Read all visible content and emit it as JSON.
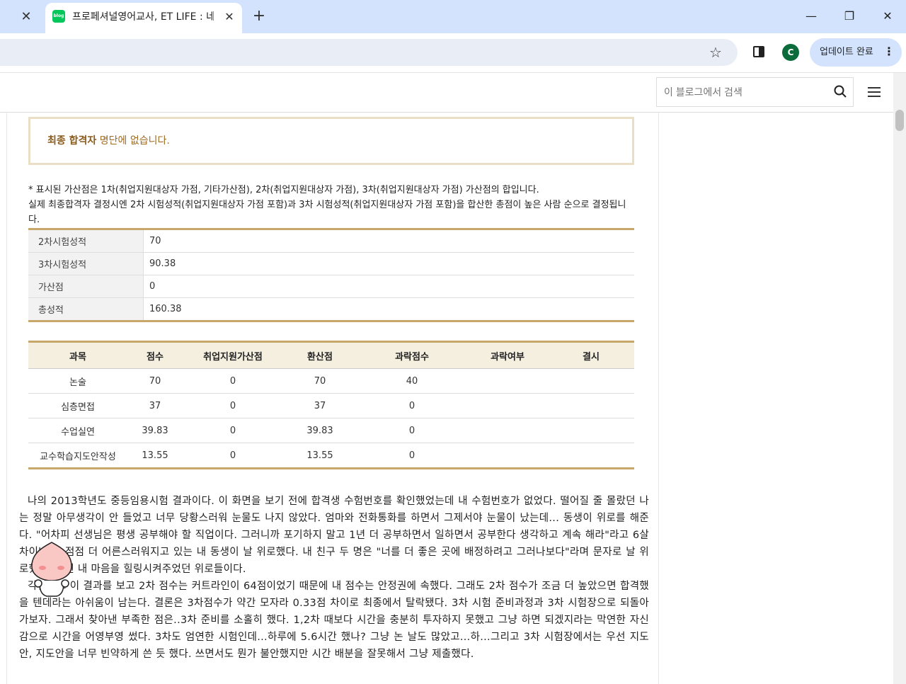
{
  "browser": {
    "tab_title": "프로페셔널영어교사, ET LIFE : 네",
    "favicon_text": "blog",
    "tab_close": "✕",
    "new_tab": "+",
    "close_x": "✕",
    "avatar_letter": "C",
    "update_label": "업데이트 완료",
    "kebab": "⋮",
    "window_controls": [
      "—",
      "❐",
      "✕"
    ]
  },
  "header": {
    "search_placeholder": "이 블로그에서 검색"
  },
  "result": {
    "highlight": "최종 합격자",
    "rest": " 명단에 없습니다."
  },
  "note_lines": [
    "* 표시된 가산점은 1차(취업지원대상자 가점, 기타가산점), 2차(취업지원대상자 가점), 3차(취업지원대상자 가점) 가산점의 합입니다.",
    "실제 최종합격자 결정시엔 2차 시험성적(취업지원대상자 가점 포함)과 3차 시험성적(취업지원대상자 가점 포함)을 합산한 총점이 높은 사람 순으로 결정됩니다."
  ],
  "score_rows": [
    {
      "label": "2차시험성적",
      "value": "70"
    },
    {
      "label": "3차시험성적",
      "value": "90.38"
    },
    {
      "label": "가산점",
      "value": "0"
    },
    {
      "label": "총성적",
      "value": "160.38"
    }
  ],
  "subject_table": {
    "headers": [
      "과목",
      "점수",
      "취업지원가산점",
      "환산점",
      "과락점수",
      "과락여부",
      "결시"
    ],
    "rows": [
      [
        "논술",
        "70",
        "0",
        "70",
        "40",
        "",
        ""
      ],
      [
        "심층면접",
        "37",
        "0",
        "37",
        "0",
        "",
        ""
      ],
      [
        "수업실연",
        "39.83",
        "0",
        "39.83",
        "0",
        "",
        ""
      ],
      [
        "교수학습지도안작성",
        "13.55",
        "0",
        "13.55",
        "0",
        "",
        ""
      ]
    ]
  },
  "body": {
    "p1": "나의 2013학년도 중등임용시험 결과이다. 이 화면을 보기 전에 합격생 수험번호를 확인했었는데 내 수험번호가 없었다. 떨어질 줄 몰랐던 나는 정말 아무생각이 안 들었고 너무 당황스러워 눈물도 나지 않았다. 엄마와 전화통화를 하면서 그제서야 눈물이 났는데... 동생이 위로를 해준다. \"어차피 선생님은 평생 공부해야 할 직업이다. 그러니까 포기하지 말고 1년 더 공부하면서 일하면서 공부한다 생각하고 계속 해라\"라고 6살 차이나는, 점점 더 어른스러워지고 있는 내 동생이 날 위로했다. 내 친구 두 명은 \"너를 더 좋은 곳에 배정하려고 그러나보다\"라며 문자로 날 위로했다. 다친 내 마음을 힐링시켜주었던 위로들이다.",
    "p2": "각설하고 이 결과를 보고 2차 점수는 커트라인이 64점이었기 때문에 내 점수는 안정권에 속했다. 그래도 2차 점수가 조금 더 높았으면 합격했을 텐데라는 아쉬움이 남는다. 결론은 3차점수가 약간 모자라 0.33점 차이로 최종에서 탈락됐다. 3차 시험 준비과정과 3차 시험장으로 되돌아가보자. 그래서 찾아낸 부족한 점은..3차 준비를 소홀히 했다. 1,2차 때보다 시간을 충분히 투자하지 못했고 그냥 하면 되겠지라는 막연한 자신감으로 시간을 어영부영 썼다. 3차도 엄연한 시험인데...하루에 5.6시간 했나? 그냥 논 날도 많았고...하...그리고 3차 시험장에서는 우선 지도안, 지도안을 너무 빈약하게 쓴 듯 했다. 쓰면서도 뭔가 불안했지만 시간 배분을 잘못해서 그냥 제출했다."
  }
}
